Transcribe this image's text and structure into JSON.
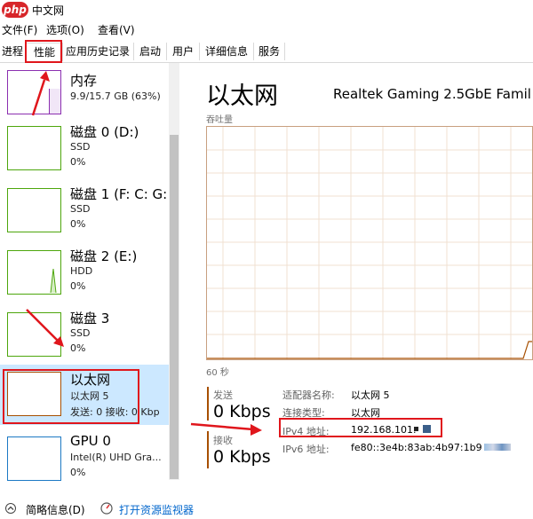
{
  "window": {
    "logo_text": "php",
    "title": "中文网"
  },
  "menu": [
    "文件(F)",
    "选项(O)",
    "查看(V)"
  ],
  "tabs": [
    "进程",
    "性能",
    "应用历史记录",
    "启动",
    "用户",
    "详细信息",
    "服务"
  ],
  "sidebar": {
    "items": [
      {
        "name": "内存",
        "sub1": "9.9/15.7 GB (63%)",
        "sub2": ""
      },
      {
        "name": "磁盘 0 (D:)",
        "sub1": "SSD",
        "sub2": "0%"
      },
      {
        "name": "磁盘 1 (F: C: G:",
        "sub1": "SSD",
        "sub2": "0%"
      },
      {
        "name": "磁盘 2 (E:)",
        "sub1": "HDD",
        "sub2": "0%"
      },
      {
        "name": "磁盘 3",
        "sub1": "SSD",
        "sub2": "0%"
      },
      {
        "name": "以太网",
        "sub1": "以太网 5",
        "sub2": "发送: 0 接收: 0 Kbp"
      },
      {
        "name": "GPU 0",
        "sub1": "Intel(R) UHD Gra...",
        "sub2": "0%"
      }
    ]
  },
  "detail": {
    "title": "以太网",
    "adapter": "Realtek Gaming 2.5GbE Famil",
    "graph_label": "吞吐量",
    "time_label": "60 秒",
    "send_label": "发送",
    "send_value": "0 Kbps",
    "recv_label": "接收",
    "recv_value": "0 Kbps",
    "props": [
      {
        "key": "适配器名称:",
        "value": "以太网 5"
      },
      {
        "key": "连接类型:",
        "value": "以太网"
      },
      {
        "key": "IPv4 地址:",
        "value": "192.168.101."
      },
      {
        "key": "IPv6 地址:",
        "value": "fe80::3e4b:83ab:4b97:1b9"
      }
    ]
  },
  "footer": {
    "summary_label": "简略信息(D)",
    "resmon_label": "打开资源监视器"
  },
  "colors": {
    "memory": "#8b2fb0",
    "disk": "#4da60c",
    "ethernet": "#a74f01",
    "gpu": "#1c79c4",
    "highlight": "#e0161c",
    "selected": "#cce8ff"
  }
}
